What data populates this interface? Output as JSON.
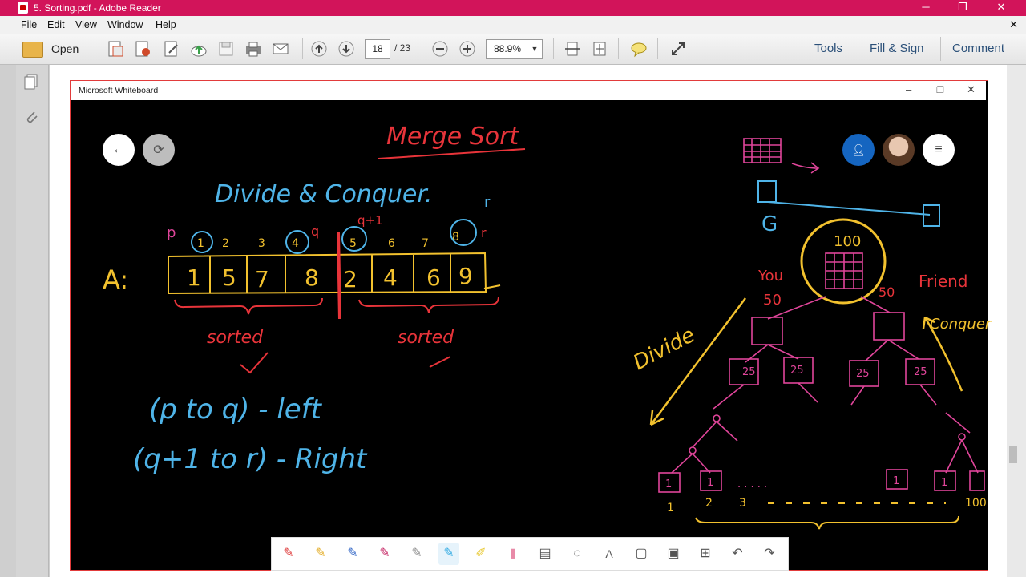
{
  "window": {
    "title": "5. Sorting.pdf - Adobe Reader"
  },
  "menu": [
    "File",
    "Edit",
    "View",
    "Window",
    "Help"
  ],
  "toolbar": {
    "open_label": "Open",
    "page_current": "18",
    "page_total": "/ 23",
    "zoom": "88.9%",
    "tools_label": "Tools",
    "fill_sign_label": "Fill & Sign",
    "comment_label": "Comment"
  },
  "whiteboard": {
    "title": "Microsoft Whiteboard",
    "heading": "Merge Sort",
    "subheading": "Divide & Conquer.",
    "array_label": "A:",
    "array_values": [
      "1",
      "5",
      "7",
      "8",
      "2",
      "4",
      "6",
      "9"
    ],
    "indices": [
      "1",
      "2",
      "3",
      "4",
      "5",
      "6",
      "7",
      "8"
    ],
    "marks": {
      "p": "p",
      "q": "q",
      "q1": "q+1",
      "r": "r",
      "r2": "r"
    },
    "sorted_left": "sorted",
    "sorted_right": "sorted",
    "left_range": "(p to q) - left",
    "right_range": "(q+1 to r) - Right",
    "tree": {
      "root": "100",
      "you": "You",
      "friend": "Friend",
      "you_val": "50",
      "friend_val": "50",
      "g": "G",
      "divide": "Divide",
      "conquer": "Conquer",
      "level2": [
        "25",
        "25",
        "25",
        "25"
      ],
      "leaf_labels": [
        "1",
        "2",
        "3",
        "100"
      ],
      "leaf_box": "1",
      "dots": ". . . . ."
    }
  },
  "colors": {
    "title_bar": "#d2145a",
    "ink_red": "#e8343a",
    "ink_yellow": "#f2c12e",
    "ink_blue": "#4fb4e8",
    "ink_pink": "#e0459a",
    "avatar_blue": "#1565c0"
  }
}
